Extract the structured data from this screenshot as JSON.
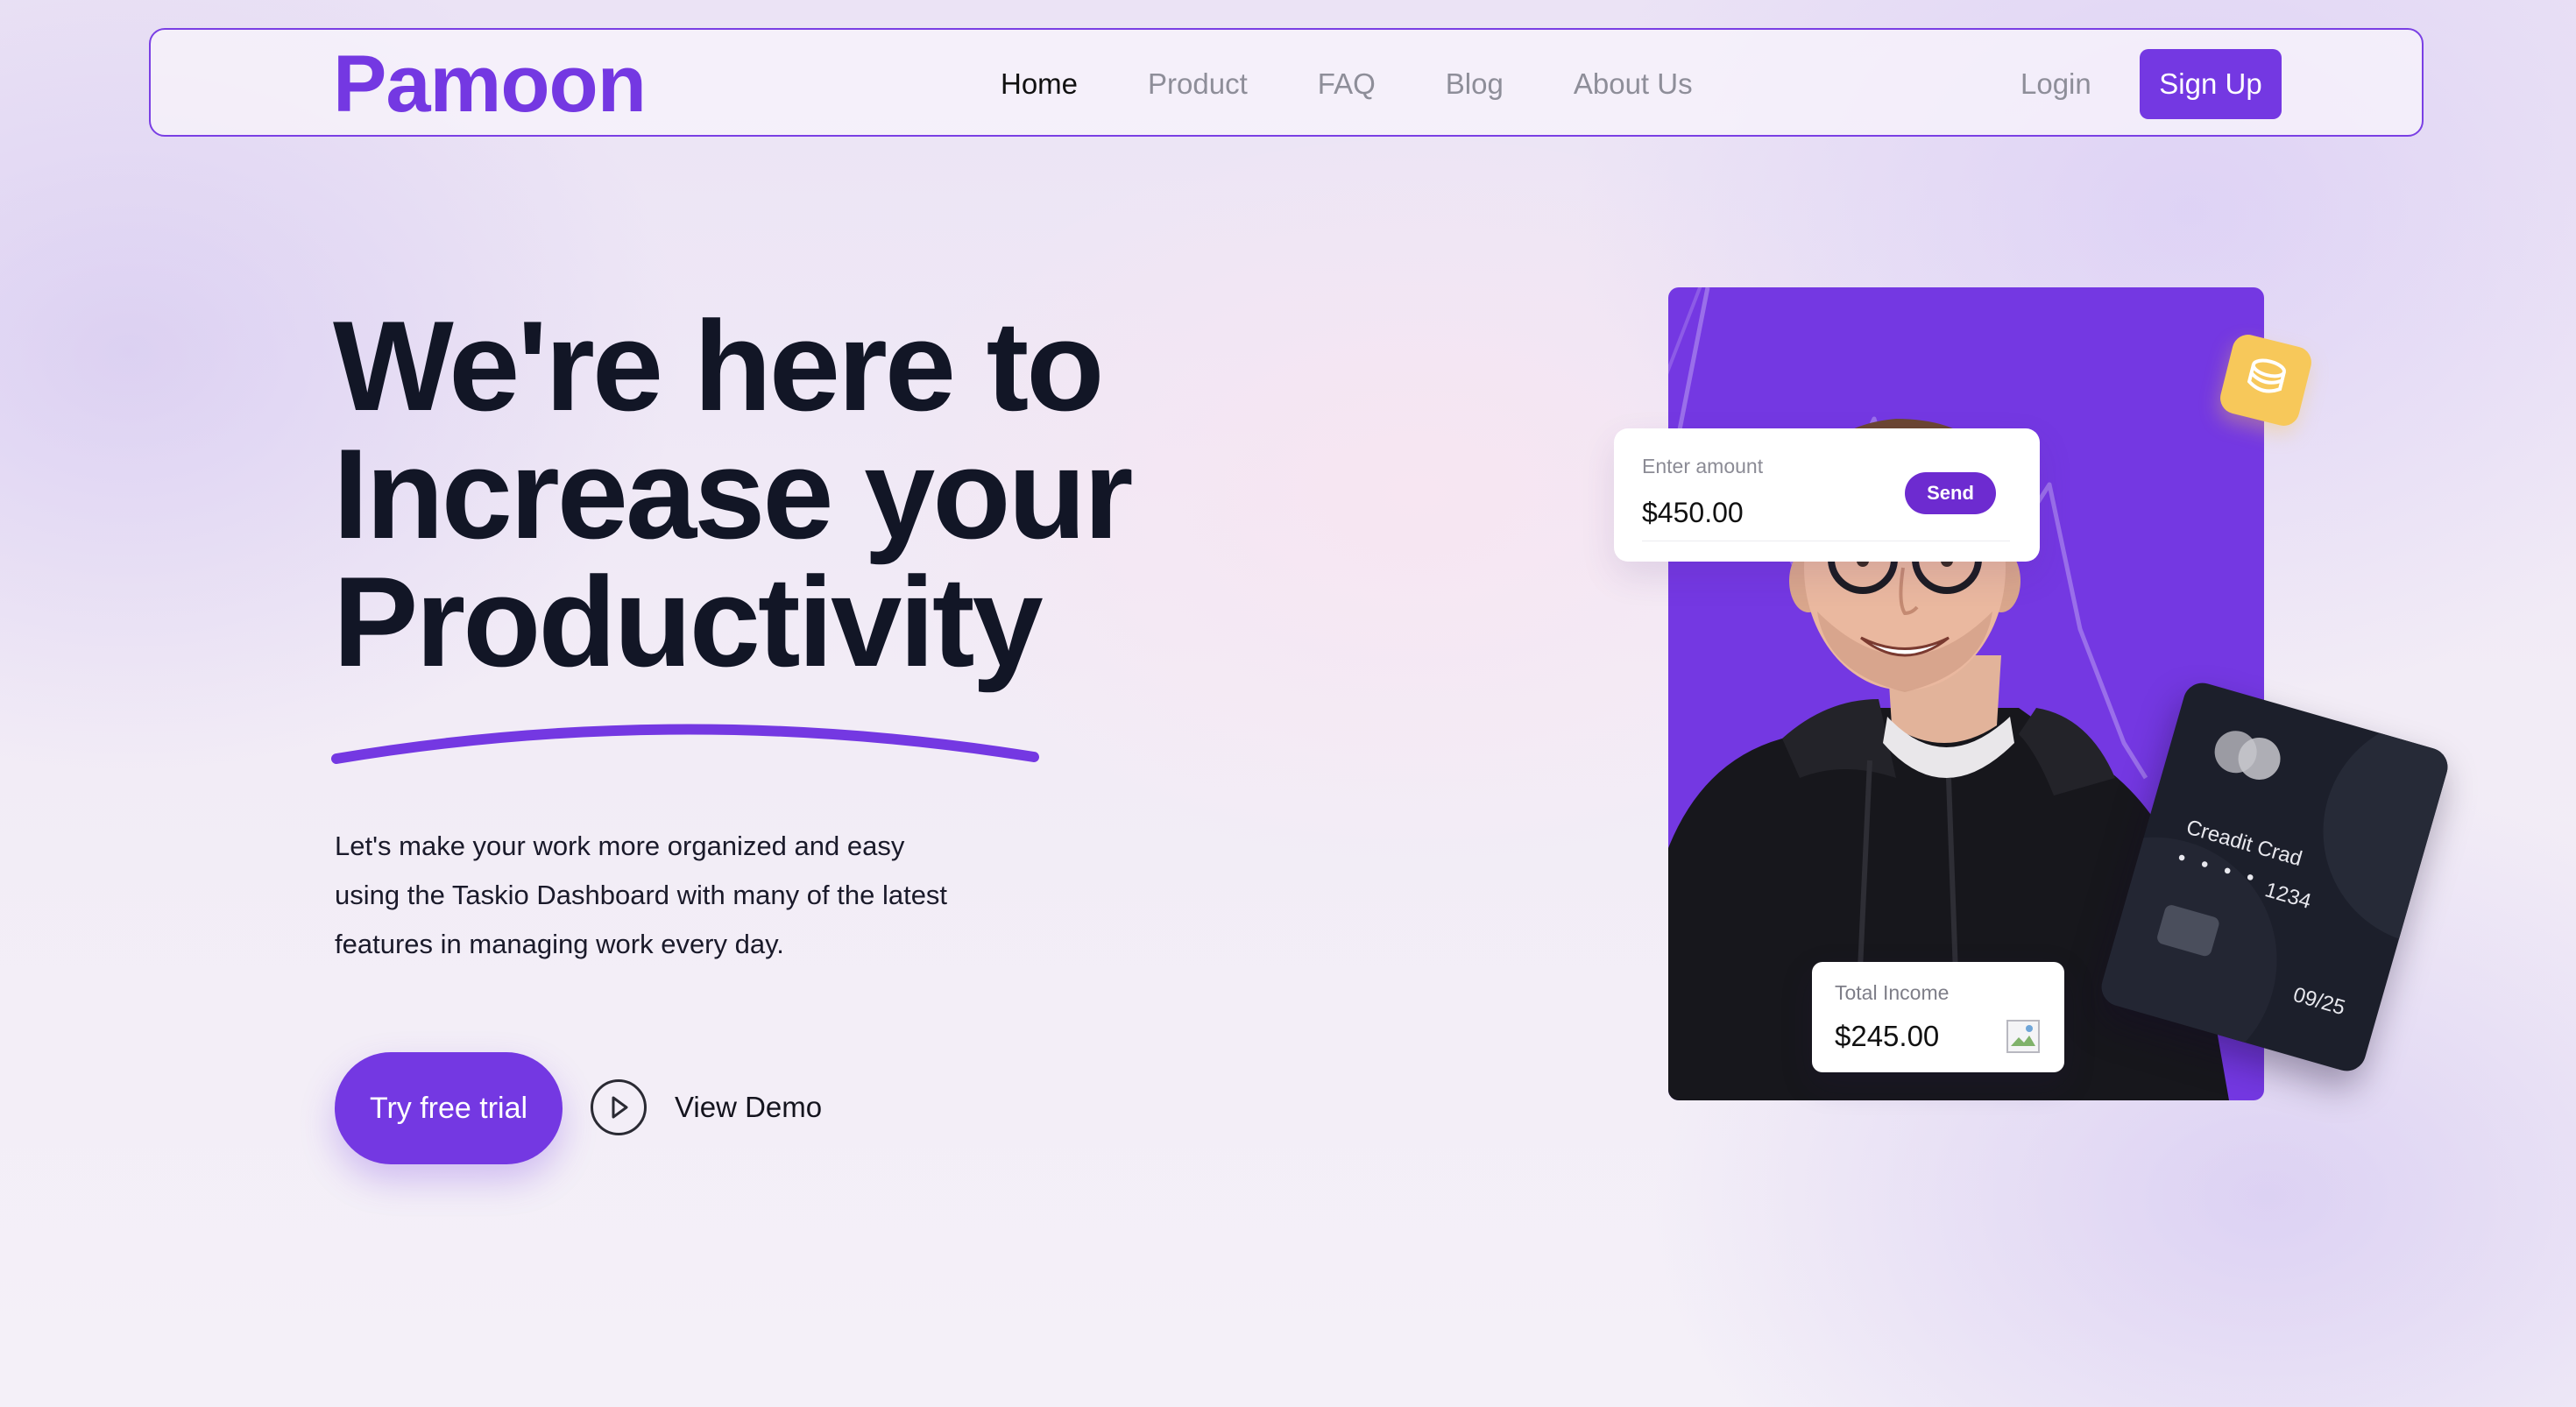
{
  "nav": {
    "brand": "Pamoon",
    "links": [
      {
        "label": "Home",
        "active": true
      },
      {
        "label": "Product",
        "active": false
      },
      {
        "label": "FAQ",
        "active": false
      },
      {
        "label": "Blog",
        "active": false
      },
      {
        "label": "About Us",
        "active": false
      }
    ],
    "login_label": "Login",
    "signup_label": "Sign Up"
  },
  "hero": {
    "title_lines": [
      "We're here to",
      "Increase your",
      "Productivity"
    ],
    "description_lines": [
      "Let's make your work more organized and easy",
      "using the Taskio Dashboard with many of the latest",
      "features in managing work every day."
    ],
    "trial_label": "Try free trial",
    "demo_label": "View Demo"
  },
  "amount_card": {
    "label": "Enter amount",
    "value": "$450.00",
    "send_label": "Send"
  },
  "income_card": {
    "label": "Total Income",
    "value": "$245.00"
  },
  "credit_card": {
    "name": "Creadit Crad",
    "dots": "• • • •",
    "number": "1234",
    "expiry": "09/25"
  },
  "colors": {
    "accent": "#7438e2",
    "accent_dark": "#6d2bd0",
    "text_dark": "#121626",
    "text_muted": "#8e8e99",
    "coin": "#f7c85a",
    "card_dark": "#1c1f2b"
  },
  "icons": {
    "play": "play-circle-icon",
    "coin": "coin-stack-icon",
    "card_brand": "mastercard-icon",
    "broken_image": "broken-image-icon"
  }
}
